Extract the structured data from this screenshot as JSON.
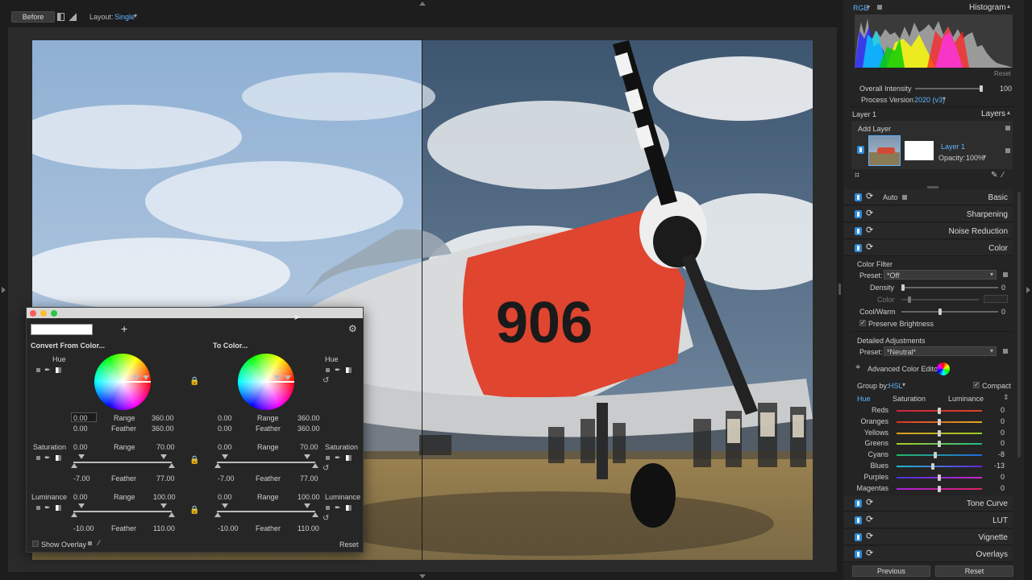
{
  "toolbar": {
    "before_label": "Before",
    "layout_label": "Layout:",
    "layout_value": "Single"
  },
  "histogram": {
    "channel": "RGB",
    "title": "Histogram",
    "reset_label": "Reset",
    "overall_intensity_label": "Overall Intensity",
    "overall_intensity_value": "100",
    "overall_intensity_level": 1.0,
    "process_version_label": "Process Version",
    "process_version_value": "2020 (v3)"
  },
  "layers": {
    "current_layer": "Layer 1",
    "title": "Layers",
    "add_layer_label": "Add Layer",
    "layer_name": "Layer 1",
    "opacity_label": "Opacity:",
    "opacity_value": "100%"
  },
  "sections": {
    "auto_label": "Auto",
    "basic": "Basic",
    "sharpening": "Sharpening",
    "noise_reduction": "Noise Reduction",
    "color": "Color",
    "tone_curve": "Tone Curve",
    "lut": "LUT",
    "vignette": "Vignette",
    "overlays": "Overlays"
  },
  "color_filter": {
    "title": "Color Filter",
    "preset_label": "Preset:",
    "preset_value": "*Off",
    "density_label": "Density",
    "density_value": "0",
    "color_label": "Color",
    "cool_warm_label": "Cool/Warm",
    "cool_warm_value": "0",
    "preserve_brightness_label": "Preserve Brightness",
    "preserve_brightness_checkmark": "✓"
  },
  "detailed": {
    "title": "Detailed Adjustments",
    "preset_label": "Preset:",
    "preset_value": "*Neutral*",
    "advanced_color_editor_label": "Advanced Color Editor",
    "group_by_label": "Group by:",
    "group_by_value": "HSL",
    "compact_label": "Compact",
    "compact_checkmark": "✓",
    "tabs": [
      "Hue",
      "Saturation",
      "Luminance"
    ],
    "rows": [
      {
        "name": "Reds",
        "value": "0",
        "level": 0.0
      },
      {
        "name": "Oranges",
        "value": "0",
        "level": 0.0
      },
      {
        "name": "Yellows",
        "value": "0",
        "level": 0.0
      },
      {
        "name": "Greens",
        "value": "0",
        "level": 0.0
      },
      {
        "name": "Cyans",
        "value": "-8",
        "level": -8
      },
      {
        "name": "Blues",
        "value": "-13",
        "level": -13
      },
      {
        "name": "Purples",
        "value": "0",
        "level": 0.0
      },
      {
        "name": "Magentas",
        "value": "0",
        "level": 0.0
      }
    ]
  },
  "footer": {
    "previous_label": "Previous",
    "reset_label": "Reset"
  },
  "dialog": {
    "add_icon_label": "+",
    "convert_from_title": "Convert From Color...",
    "to_color_title": "To Color...",
    "hue_label": "Hue",
    "saturation_label": "Saturation",
    "luminance_label": "Luminance",
    "range_label": "Range",
    "feather_label": "Feather",
    "from_hue": {
      "input_value": "0.00",
      "range_value": "360.00",
      "feather_left": "0.00",
      "feather_value": "360.00"
    },
    "to_hue": {
      "range_left": "0.00",
      "range_value": "360.00",
      "feather_left": "0.00",
      "feather_value": "360.00"
    },
    "from_sat": {
      "range_left": "0.00",
      "range_value": "70.00",
      "feather_left": "-7.00",
      "feather_value": "77.00"
    },
    "to_sat": {
      "range_left": "0.00",
      "range_value": "70.00",
      "feather_left": "-7.00",
      "feather_value": "77.00"
    },
    "from_lum": {
      "range_left": "0.00",
      "range_value": "100.00",
      "feather_left": "-10.00",
      "feather_value": "110.00"
    },
    "to_lum": {
      "range_left": "0.00",
      "range_value": "100.00",
      "feather_left": "-10.00",
      "feather_value": "110.00"
    },
    "show_overlay_label": "Show Overlay",
    "reset_label": "Reset"
  },
  "photo": {
    "plane_number": "906"
  },
  "colors": {
    "accent": "#5fb4ff",
    "toggle": "#2f8bd8",
    "plane_red": "#e0452f"
  }
}
